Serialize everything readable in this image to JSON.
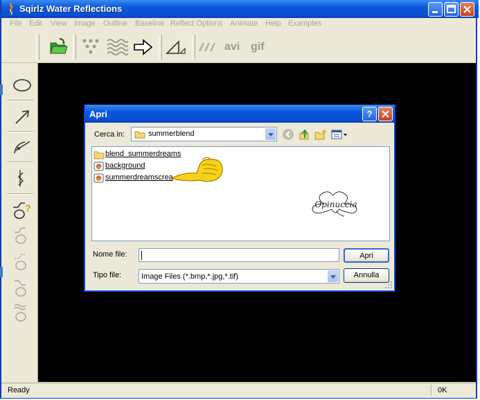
{
  "app": {
    "title": "Sqirlz Water Reflections"
  },
  "menu": [
    "File",
    "Edit",
    "View",
    "Image",
    "Outline",
    "Baseline",
    "Reflect Options",
    "Animate",
    "Help",
    "Examples"
  ],
  "toolbar": {
    "avi_label": "avi",
    "gif_label": "gif"
  },
  "status": {
    "text": "Ready",
    "right": "0K"
  },
  "dialog": {
    "title": "Apri",
    "look_in_label": "Cerca in:",
    "look_in_value": "summerblend",
    "files": [
      {
        "name": "blend_summerdreams",
        "type": "folder"
      },
      {
        "name": "background",
        "type": "image"
      },
      {
        "name": "summerdreamscrea",
        "type": "image"
      }
    ],
    "filename_label": "Nome file:",
    "filename_value": "",
    "filetype_label": "Tipo file:",
    "filetype_value": "Image Files (*.bmp,*.jpg,*.tif)",
    "open_button": "Apri",
    "cancel_button": "Annulla",
    "watermark": "Opinuccia"
  },
  "colors": {
    "titlebar": "#0a58dd",
    "canvas": "#000000",
    "face": "#ece9d8"
  }
}
